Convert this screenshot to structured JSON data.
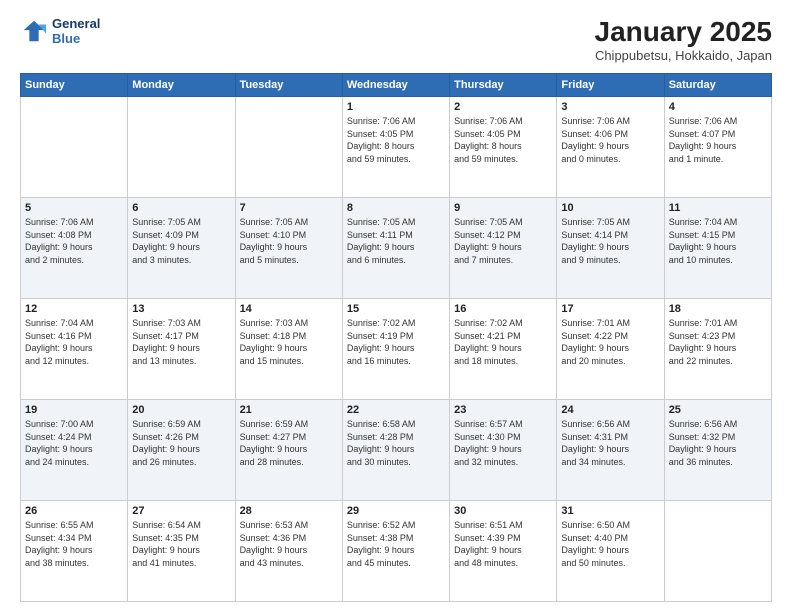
{
  "header": {
    "logo_line1": "General",
    "logo_line2": "Blue",
    "title": "January 2025",
    "subtitle": "Chippubetsu, Hokkaido, Japan"
  },
  "days_of_week": [
    "Sunday",
    "Monday",
    "Tuesday",
    "Wednesday",
    "Thursday",
    "Friday",
    "Saturday"
  ],
  "weeks": [
    [
      {
        "num": "",
        "info": ""
      },
      {
        "num": "",
        "info": ""
      },
      {
        "num": "",
        "info": ""
      },
      {
        "num": "1",
        "info": "Sunrise: 7:06 AM\nSunset: 4:05 PM\nDaylight: 8 hours\nand 59 minutes."
      },
      {
        "num": "2",
        "info": "Sunrise: 7:06 AM\nSunset: 4:05 PM\nDaylight: 8 hours\nand 59 minutes."
      },
      {
        "num": "3",
        "info": "Sunrise: 7:06 AM\nSunset: 4:06 PM\nDaylight: 9 hours\nand 0 minutes."
      },
      {
        "num": "4",
        "info": "Sunrise: 7:06 AM\nSunset: 4:07 PM\nDaylight: 9 hours\nand 1 minute."
      }
    ],
    [
      {
        "num": "5",
        "info": "Sunrise: 7:06 AM\nSunset: 4:08 PM\nDaylight: 9 hours\nand 2 minutes."
      },
      {
        "num": "6",
        "info": "Sunrise: 7:05 AM\nSunset: 4:09 PM\nDaylight: 9 hours\nand 3 minutes."
      },
      {
        "num": "7",
        "info": "Sunrise: 7:05 AM\nSunset: 4:10 PM\nDaylight: 9 hours\nand 5 minutes."
      },
      {
        "num": "8",
        "info": "Sunrise: 7:05 AM\nSunset: 4:11 PM\nDaylight: 9 hours\nand 6 minutes."
      },
      {
        "num": "9",
        "info": "Sunrise: 7:05 AM\nSunset: 4:12 PM\nDaylight: 9 hours\nand 7 minutes."
      },
      {
        "num": "10",
        "info": "Sunrise: 7:05 AM\nSunset: 4:14 PM\nDaylight: 9 hours\nand 9 minutes."
      },
      {
        "num": "11",
        "info": "Sunrise: 7:04 AM\nSunset: 4:15 PM\nDaylight: 9 hours\nand 10 minutes."
      }
    ],
    [
      {
        "num": "12",
        "info": "Sunrise: 7:04 AM\nSunset: 4:16 PM\nDaylight: 9 hours\nand 12 minutes."
      },
      {
        "num": "13",
        "info": "Sunrise: 7:03 AM\nSunset: 4:17 PM\nDaylight: 9 hours\nand 13 minutes."
      },
      {
        "num": "14",
        "info": "Sunrise: 7:03 AM\nSunset: 4:18 PM\nDaylight: 9 hours\nand 15 minutes."
      },
      {
        "num": "15",
        "info": "Sunrise: 7:02 AM\nSunset: 4:19 PM\nDaylight: 9 hours\nand 16 minutes."
      },
      {
        "num": "16",
        "info": "Sunrise: 7:02 AM\nSunset: 4:21 PM\nDaylight: 9 hours\nand 18 minutes."
      },
      {
        "num": "17",
        "info": "Sunrise: 7:01 AM\nSunset: 4:22 PM\nDaylight: 9 hours\nand 20 minutes."
      },
      {
        "num": "18",
        "info": "Sunrise: 7:01 AM\nSunset: 4:23 PM\nDaylight: 9 hours\nand 22 minutes."
      }
    ],
    [
      {
        "num": "19",
        "info": "Sunrise: 7:00 AM\nSunset: 4:24 PM\nDaylight: 9 hours\nand 24 minutes."
      },
      {
        "num": "20",
        "info": "Sunrise: 6:59 AM\nSunset: 4:26 PM\nDaylight: 9 hours\nand 26 minutes."
      },
      {
        "num": "21",
        "info": "Sunrise: 6:59 AM\nSunset: 4:27 PM\nDaylight: 9 hours\nand 28 minutes."
      },
      {
        "num": "22",
        "info": "Sunrise: 6:58 AM\nSunset: 4:28 PM\nDaylight: 9 hours\nand 30 minutes."
      },
      {
        "num": "23",
        "info": "Sunrise: 6:57 AM\nSunset: 4:30 PM\nDaylight: 9 hours\nand 32 minutes."
      },
      {
        "num": "24",
        "info": "Sunrise: 6:56 AM\nSunset: 4:31 PM\nDaylight: 9 hours\nand 34 minutes."
      },
      {
        "num": "25",
        "info": "Sunrise: 6:56 AM\nSunset: 4:32 PM\nDaylight: 9 hours\nand 36 minutes."
      }
    ],
    [
      {
        "num": "26",
        "info": "Sunrise: 6:55 AM\nSunset: 4:34 PM\nDaylight: 9 hours\nand 38 minutes."
      },
      {
        "num": "27",
        "info": "Sunrise: 6:54 AM\nSunset: 4:35 PM\nDaylight: 9 hours\nand 41 minutes."
      },
      {
        "num": "28",
        "info": "Sunrise: 6:53 AM\nSunset: 4:36 PM\nDaylight: 9 hours\nand 43 minutes."
      },
      {
        "num": "29",
        "info": "Sunrise: 6:52 AM\nSunset: 4:38 PM\nDaylight: 9 hours\nand 45 minutes."
      },
      {
        "num": "30",
        "info": "Sunrise: 6:51 AM\nSunset: 4:39 PM\nDaylight: 9 hours\nand 48 minutes."
      },
      {
        "num": "31",
        "info": "Sunrise: 6:50 AM\nSunset: 4:40 PM\nDaylight: 9 hours\nand 50 minutes."
      },
      {
        "num": "",
        "info": ""
      }
    ]
  ]
}
